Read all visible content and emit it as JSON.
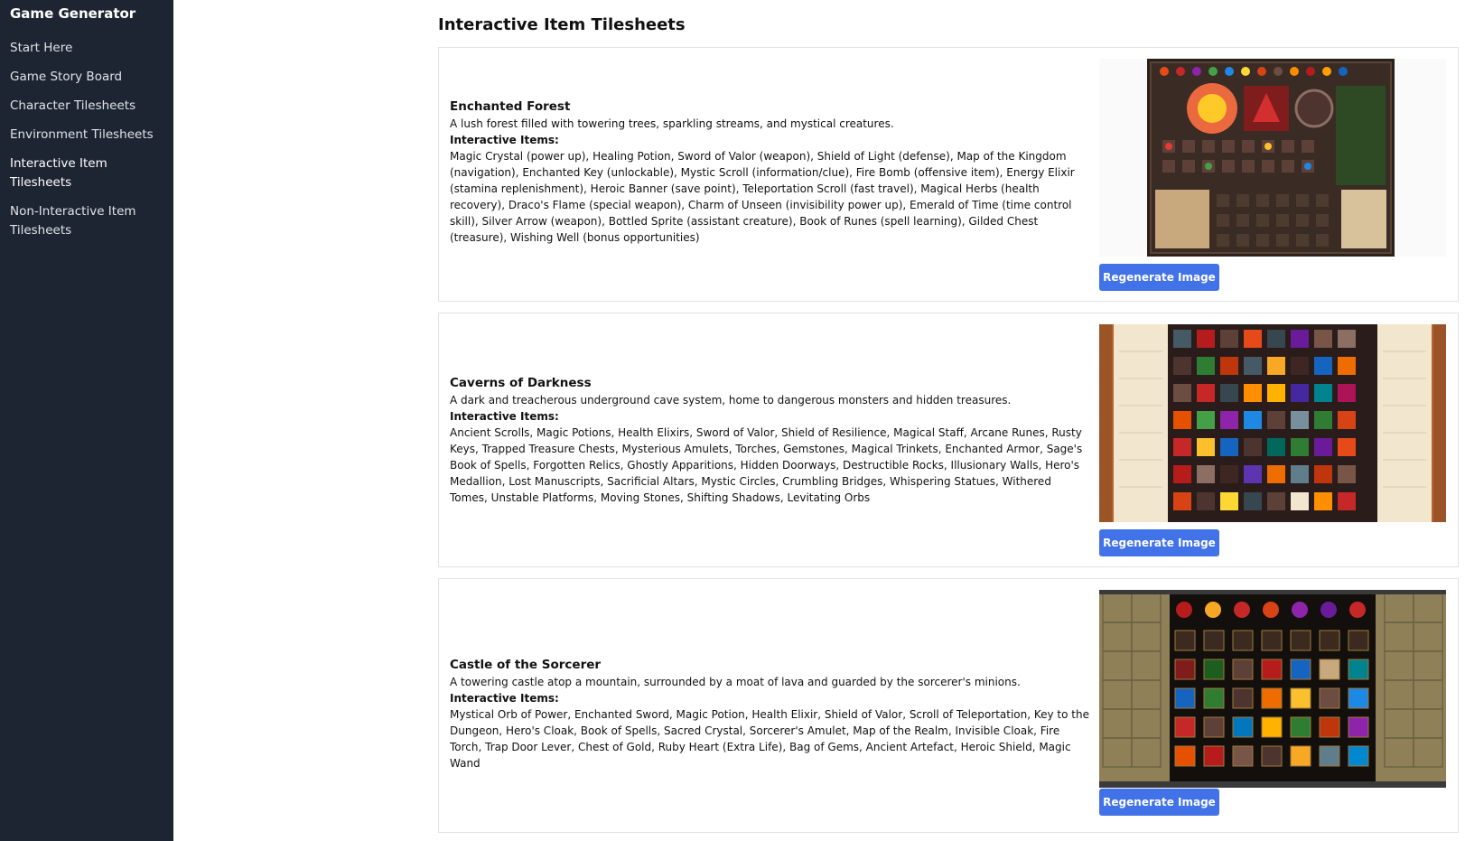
{
  "sidebar": {
    "app_title": "Game Generator",
    "items": [
      {
        "label": "Start Here"
      },
      {
        "label": "Game Story Board"
      },
      {
        "label": "Character Tilesheets"
      },
      {
        "label": "Environment Tilesheets"
      },
      {
        "label": "Interactive Item Tilesheets"
      },
      {
        "label": "Non-Interactive Item Tilesheets"
      }
    ],
    "active_item": "Interactive Item Tilesheets"
  },
  "main": {
    "title": "Interactive Item Tilesheets",
    "items_label": "Interactive Items:",
    "regenerate_label": "Regenerate Image",
    "cards": [
      {
        "title": "Enchanted Forest",
        "description": "A lush forest filled with towering trees, sparkling streams, and mystical creatures.",
        "items": "Magic Crystal (power up), Healing Potion, Sword of Valor (weapon), Shield of Light (defense), Map of the Kingdom (navigation), Enchanted Key (unlockable), Mystic Scroll (information/clue), Fire Bomb (offensive item), Energy Elixir (stamina replenishment), Heroic Banner (save point), Teleportation Scroll (fast travel), Magical Herbs (health recovery), Draco's Flame (special weapon), Charm of Unseen (invisibility power up), Emerald of Time (time control skill), Silver Arrow (weapon), Bottled Sprite (assistant creature), Book of Runes (spell learning), Gilded Chest (treasure), Wishing Well (bonus opportunities)",
        "image": "tilesheet-image"
      },
      {
        "title": "Caverns of Darkness",
        "description": "A dark and treacherous underground cave system, home to dangerous monsters and hidden treasures.",
        "items": "Ancient Scrolls, Magic Potions, Health Elixirs, Sword of Valor, Shield of Resilience, Magical Staff, Arcane Runes, Rusty Keys, Trapped Treasure Chests, Mysterious Amulets, Torches, Gemstones, Magical Trinkets, Enchanted Armor, Sage's Book of Spells, Forgotten Relics, Ghostly Apparitions, Hidden Doorways, Destructible Rocks, Illusionary Walls, Hero's Medallion, Lost Manuscripts, Sacrificial Altars, Mystic Circles, Crumbling Bridges, Whispering Statues, Withered Tomes, Unstable Platforms, Moving Stones, Shifting Shadows, Levitating Orbs",
        "image": "tilesheet-image"
      },
      {
        "title": "Castle of the Sorcerer",
        "description": "A towering castle atop a mountain, surrounded by a moat of lava and guarded by the sorcerer's minions.",
        "items": "Mystical Orb of Power, Enchanted Sword, Magic Potion, Health Elixir, Shield of Valor, Scroll of Teleportation, Key to the Dungeon, Hero's Cloak, Book of Spells, Sacred Crystal, Sorcerer's Amulet, Map of the Realm, Invisible Cloak, Fire Torch, Trap Door Lever, Chest of Gold, Ruby Heart (Extra Life), Bag of Gems, Ancient Artefact, Heroic Shield, Magic Wand",
        "image": "tilesheet-image"
      }
    ]
  },
  "colors": {
    "sidebar_bg": "#1e2532",
    "accent_button": "#4272e8"
  }
}
